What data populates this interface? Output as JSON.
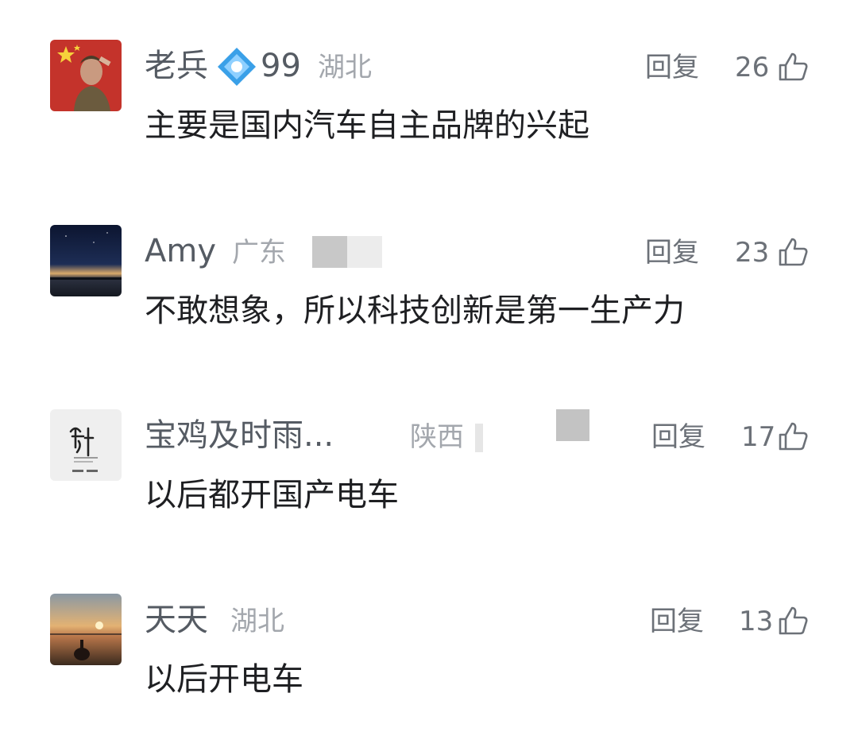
{
  "comments": [
    {
      "name": "老兵",
      "level": "99",
      "region": "湖北",
      "reply_label": "回复",
      "likes": "26",
      "text": "主要是国内汽车自主品牌的兴起"
    },
    {
      "name": "Amy",
      "region": "广东",
      "reply_label": "回复",
      "likes": "23",
      "text": "不敢想象，所以科技创新是第一生产力"
    },
    {
      "name": "宝鸡及时雨...",
      "region": "陕西",
      "reply_label": "回复",
      "likes": "17",
      "text": "以后都开国产电车"
    },
    {
      "name": "天天",
      "region": "湖北",
      "reply_label": "回复",
      "likes": "13",
      "text": "以后开电车"
    }
  ],
  "icons": {
    "like": "thumbs-up-icon",
    "level_badge": "diamond-badge-icon"
  },
  "colors": {
    "name": "#555b63",
    "region": "#a3a7ad",
    "text": "#1e1f22",
    "action": "#6c7178",
    "badge": "#3aa0e8"
  }
}
